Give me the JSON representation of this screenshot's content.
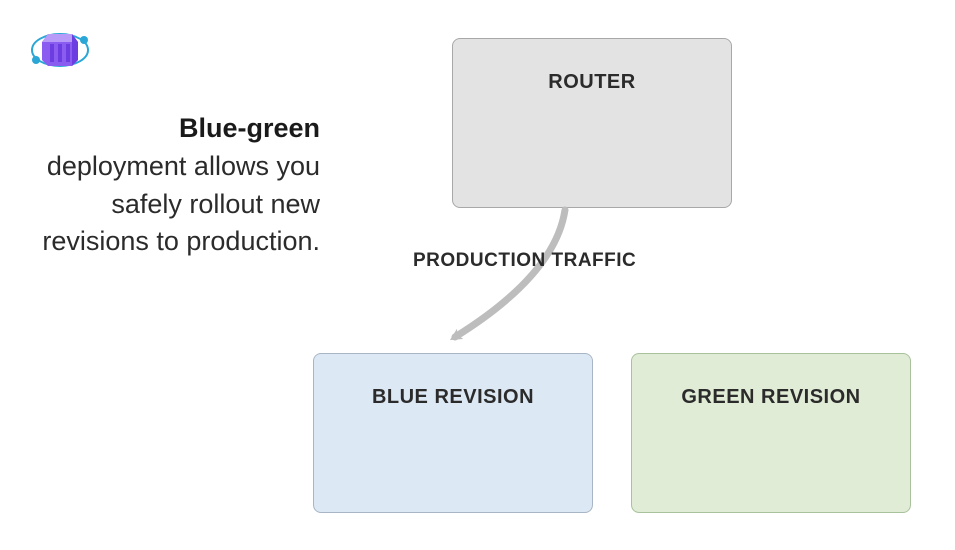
{
  "description": {
    "bold": "Blue-green",
    "rest": " deployment allows you safely rollout new revisions to production."
  },
  "boxes": {
    "router": "ROUTER",
    "blue": "BLUE REVISION",
    "green": "GREEN REVISION"
  },
  "traffic_label": "PRODUCTION TRAFFIC",
  "colors": {
    "router_bg": "#e3e3e3",
    "blue_bg": "#dde8f5",
    "green_bg": "#e0ecd6",
    "arrow": "#bdbdbd"
  }
}
